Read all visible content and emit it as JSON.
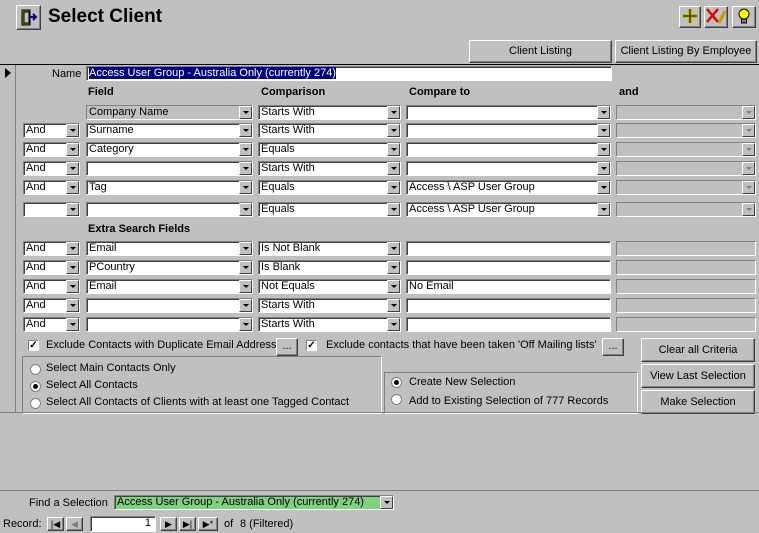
{
  "window": {
    "title": "Select Client"
  },
  "toolbar": {
    "exit_icon": "door-exit-icon",
    "add_icon": "plus-icon",
    "delete_icon": "delete-pencil-icon",
    "tip_icon": "lightbulb-icon"
  },
  "top_buttons": {
    "client_listing": "Client Listing",
    "client_listing_by_employee": "Client Listing By Employee"
  },
  "name": {
    "label": "Name",
    "value": "Access User Group - Australia Only (currently 274)"
  },
  "headers": {
    "field": "Field",
    "comparison": "Comparison",
    "compare_to": "Compare to",
    "and": "and"
  },
  "criteria_rows": [
    {
      "conj": "",
      "field": "Company Name",
      "comparison": "Starts With",
      "compare": "",
      "and": ""
    },
    {
      "conj": "And",
      "field": "Surname",
      "comparison": "Starts With",
      "compare": "",
      "and": ""
    },
    {
      "conj": "And",
      "field": "Category",
      "comparison": "Equals",
      "compare": "",
      "and": ""
    },
    {
      "conj": "And",
      "field": "",
      "comparison": "Starts With",
      "compare": "",
      "and": ""
    },
    {
      "conj": "And",
      "field": "Tag",
      "comparison": "Equals",
      "compare": "Access \\ ASP User Group",
      "and": ""
    },
    {
      "conj": "",
      "field": "",
      "comparison": "Equals",
      "compare": "Access \\ ASP User Group",
      "and": ""
    }
  ],
  "extra": {
    "header": "Extra Search Fields",
    "rows": [
      {
        "conj": "And",
        "field": "Email",
        "comparison": "Is Not Blank",
        "compare": ""
      },
      {
        "conj": "And",
        "field": "PCountry",
        "comparison": "Is Blank",
        "compare": ""
      },
      {
        "conj": "And",
        "field": "Email",
        "comparison": "Not Equals",
        "compare": "No Email"
      },
      {
        "conj": "And",
        "field": "",
        "comparison": "Starts With",
        "compare": ""
      },
      {
        "conj": "And",
        "field": "",
        "comparison": "Starts With",
        "compare": ""
      }
    ]
  },
  "options": {
    "exclude_dup_email": "Exclude Contacts with Duplicate Email Address'",
    "exclude_mailing": "Exclude contacts that have been taken 'Off Mailing lists'",
    "ellipsis": "..."
  },
  "contact_radio": {
    "main_only": "Select Main Contacts Only",
    "all": "Select All Contacts",
    "tagged": "Select All Contacts of Clients with at least one Tagged Contact"
  },
  "selection_radio": {
    "create_new": "Create New Selection",
    "add_existing": "Add to Existing Selection of 777 Records"
  },
  "actions": {
    "clear": "Clear all Criteria",
    "view_last": "View Last Selection",
    "make": "Make Selection"
  },
  "find": {
    "label": "Find a Selection",
    "value": "Access User Group - Australia Only (currently 274)"
  },
  "record_nav": {
    "label": "Record:",
    "current": "1",
    "of": "of",
    "total": "8 (Filtered)",
    "first": "|◀",
    "prev": "◀",
    "next": "▶",
    "last": "▶|",
    "new": "▶*"
  },
  "colors": {
    "background": "#c0c0c0",
    "highlight": "#000080",
    "find_bg": "#7fd27f"
  }
}
